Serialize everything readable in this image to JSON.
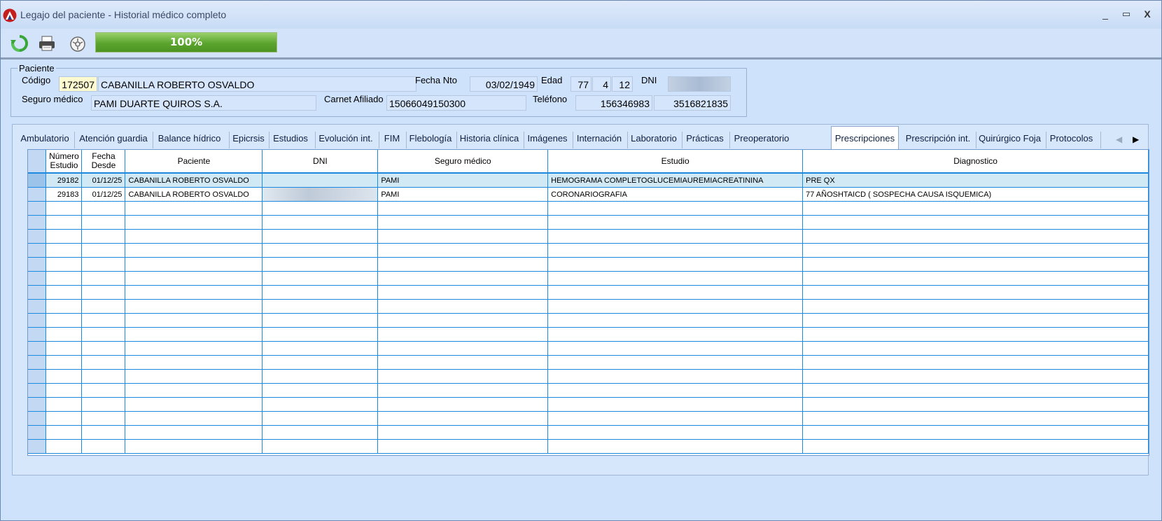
{
  "window": {
    "title": "Legajo del paciente - Historial médico completo",
    "minimize": "_",
    "maximize": "▭",
    "close": "X"
  },
  "toolbar": {
    "progress_percent": 100,
    "progress_label": "100%"
  },
  "patient": {
    "legend": "Paciente",
    "codigo_label": "Código",
    "codigo": "172507",
    "nombre": "CABANILLA ROBERTO OSVALDO",
    "fecha_nto_label": "Fecha Nto",
    "fecha_nto": "03/02/1949",
    "edad_label": "Edad",
    "edad_years": "77",
    "edad_months": "4",
    "edad_days": "12",
    "dni_label": "DNI",
    "seguro_label": "Seguro médico",
    "seguro": "PAMI DUARTE QUIROS S.A.",
    "carnet_label": "Carnet Afiliado",
    "carnet": "15066049150300",
    "telefono_label": "Teléfono",
    "telefono1": "156346983",
    "telefono2": "3516821835"
  },
  "tabs": [
    "Ambulatorio",
    "Atención guardia",
    "Balance hídrico",
    "Epicrsis",
    "Estudios",
    "Evolución int.",
    "FIM",
    "Flebología",
    "Historia clínica",
    "Imágenes",
    "Internación",
    "Laboratorio",
    "Prácticas",
    "Preoperatorio",
    "Prescripciones",
    "Prescripción int.",
    "Quirúrgico Foja",
    "Protocolos"
  ],
  "active_tab": "Prescripciones",
  "grid": {
    "columns": [
      {
        "l1": "Número",
        "l2": "Estudio"
      },
      {
        "l1": "Fecha",
        "l2": "Desde"
      },
      {
        "l1": "Paciente",
        "l2": ""
      },
      {
        "l1": "DNI",
        "l2": ""
      },
      {
        "l1": "Seguro médico",
        "l2": ""
      },
      {
        "l1": "Estudio",
        "l2": ""
      },
      {
        "l1": "Diagnostico",
        "l2": ""
      }
    ],
    "rows": [
      {
        "numero": "29182",
        "fecha": "01/12/25",
        "paciente": "CABANILLA ROBERTO OSVALDO",
        "dni": "",
        "seguro": "PAMI",
        "estudio": "HEMOGRAMA COMPLETOGLUCEMIAUREMIACREATININA",
        "diagnostico": "PRE QX"
      },
      {
        "numero": "29183",
        "fecha": "01/12/25",
        "paciente": "CABANILLA ROBERTO OSVALDO",
        "dni": "",
        "seguro": "PAMI",
        "estudio": "CORONARIOGRAFIA",
        "diagnostico": "77 AÑOSHTAICD ( SOSPECHA CAUSA ISQUEMICA)"
      }
    ],
    "empty_rows": 18
  }
}
